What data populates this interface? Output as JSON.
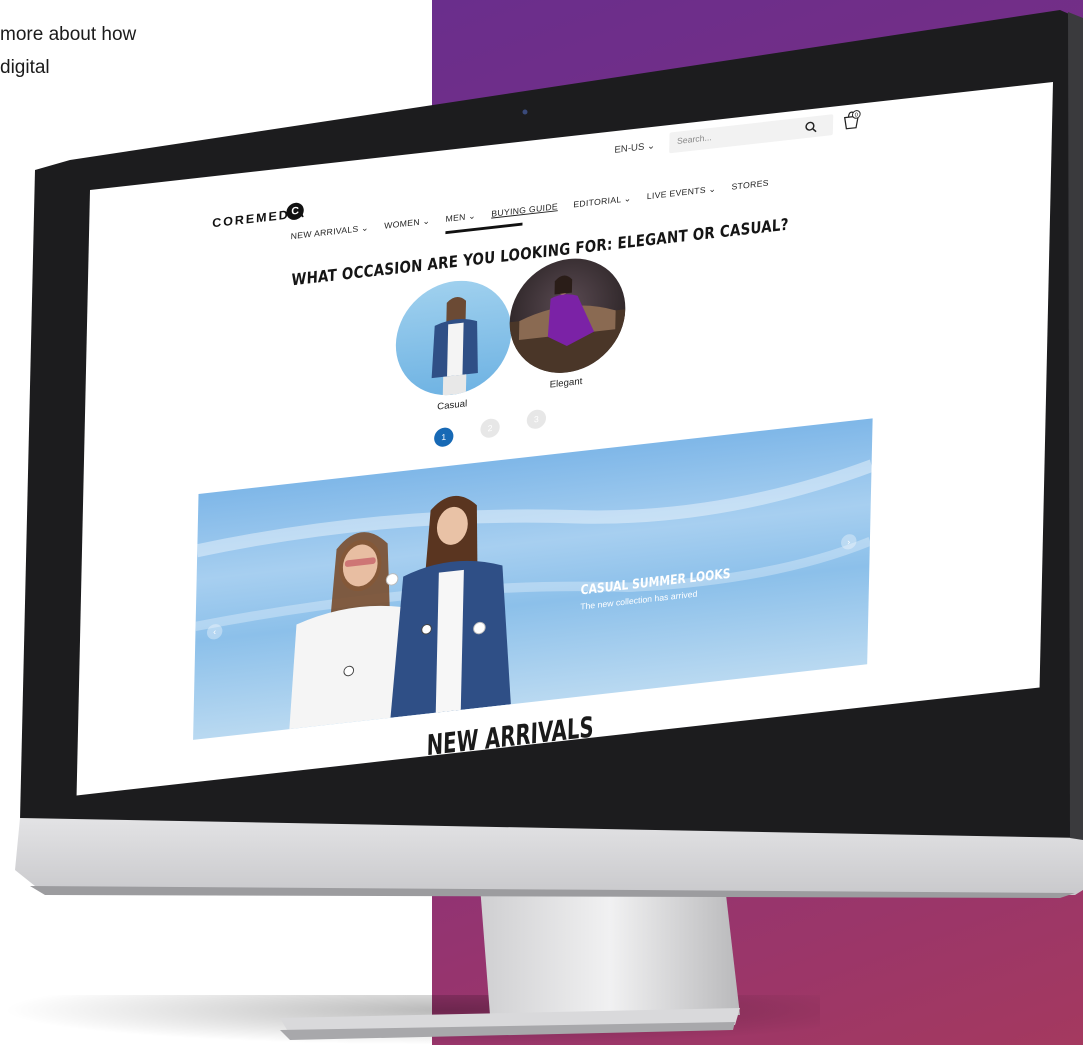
{
  "intro": {
    "text": "more about how\ndigital"
  },
  "header": {
    "locale": "EN-US",
    "search_placeholder": "Search...",
    "cart_count": "0",
    "brand": "COREMEDIA",
    "brand_mark": "C"
  },
  "nav": {
    "items": [
      {
        "label": "NEW ARRIVALS",
        "chevron": true
      },
      {
        "label": "WOMEN",
        "chevron": true
      },
      {
        "label": "MEN",
        "chevron": true
      },
      {
        "label": "BUYING GUIDE",
        "chevron": false,
        "active": true
      },
      {
        "label": "EDITORIAL",
        "chevron": true
      },
      {
        "label": "LIVE EVENTS",
        "chevron": true
      },
      {
        "label": "STORES",
        "chevron": false
      }
    ]
  },
  "occasion": {
    "question": "WHAT OCCASION ARE YOU LOOKING FOR: ELEGANT OR CASUAL?",
    "options": [
      "Casual",
      "Elegant"
    ],
    "pages": [
      "1",
      "2",
      "3"
    ],
    "active_page": "1"
  },
  "hero": {
    "title": "CASUAL SUMMER LOOKS",
    "subtitle": "The new collection has arrived",
    "prev_icon": "chevron-left-icon",
    "next_icon": "chevron-right-icon"
  },
  "section": {
    "title": "NEW ARRIVALS"
  },
  "colors": {
    "accent": "#1769b5",
    "backdrop_start": "#6a2e8c",
    "backdrop_end": "#a4395f"
  }
}
